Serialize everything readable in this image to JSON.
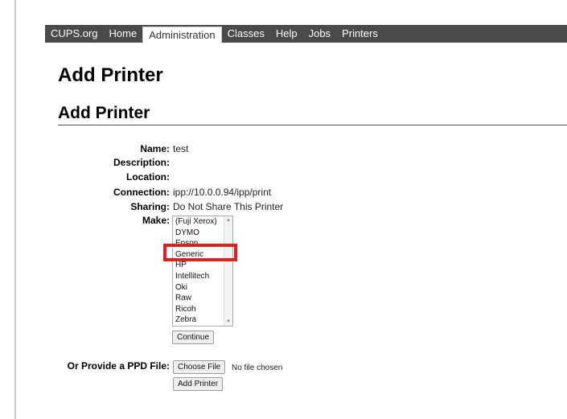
{
  "nav": {
    "items": [
      {
        "label": "CUPS.org"
      },
      {
        "label": "Home"
      },
      {
        "label": "Administration"
      },
      {
        "label": "Classes"
      },
      {
        "label": "Help"
      },
      {
        "label": "Jobs"
      },
      {
        "label": "Printers"
      }
    ],
    "active_index": 2
  },
  "page": {
    "title": "Add Printer",
    "section_title": "Add Printer"
  },
  "form": {
    "name_label": "Name:",
    "name_value": "test",
    "description_label": "Description:",
    "description_value": "",
    "location_label": "Location:",
    "location_value": "",
    "connection_label": "Connection:",
    "connection_value": "ipp://10.0.0.94/ipp/print",
    "sharing_label": "Sharing:",
    "sharing_value": "Do Not Share This Printer",
    "make_label": "Make:",
    "make_options": [
      "(Fuji Xerox)",
      "DYMO",
      "Epson",
      "Generic",
      "HP",
      "Intellitech",
      "Oki",
      "Raw",
      "Ricoh",
      "Zebra"
    ],
    "make_highlighted": "Generic",
    "continue_label": "Continue",
    "ppd_label": "Or Provide a PPD File:",
    "choose_file_label": "Choose File",
    "file_status": "No file chosen",
    "add_printer_label": "Add Printer"
  },
  "colors": {
    "navbar_bg": "#4a4a4a",
    "highlight": "#e01f1f"
  }
}
